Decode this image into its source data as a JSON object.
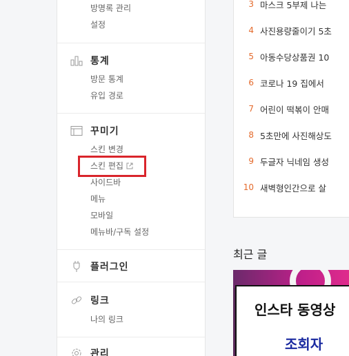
{
  "sidebar": {
    "top_items": [
      "방명록 관리",
      "설정"
    ],
    "stats": {
      "title": "통계",
      "items": [
        "방문 통계",
        "유입 경로"
      ]
    },
    "decorate": {
      "title": "꾸미기",
      "items": [
        "스킨 변경",
        "스킨 편집",
        "사이드바",
        "메뉴",
        "모바일",
        "메뉴바/구독 설정"
      ]
    },
    "plugin": {
      "title": "플러그인"
    },
    "link": {
      "title": "링크",
      "items": [
        "나의 링크"
      ]
    },
    "manage": {
      "title": "관리"
    }
  },
  "popular": [
    {
      "rank": "3",
      "text": "마스크 5부제 나는"
    },
    {
      "rank": "4",
      "text": "사진용량줄이기 5초"
    },
    {
      "rank": "5",
      "text": "아동수당상품권 10"
    },
    {
      "rank": "6",
      "text": "코로나 19 집에서"
    },
    {
      "rank": "7",
      "text": "어린이 떡볶이 안매"
    },
    {
      "rank": "8",
      "text": "5초만에 사진해상도"
    },
    {
      "rank": "9",
      "text": "두글자 닉네임 생성"
    },
    {
      "rank": "10",
      "text": "새벽형인간으로 살"
    }
  ],
  "recent": {
    "title": "최근 글",
    "thumb_line1": "인스타 동영상",
    "thumb_line2": "조회자"
  },
  "colors": {
    "highlight": "#d9242b",
    "rank": "#e46a2c"
  }
}
